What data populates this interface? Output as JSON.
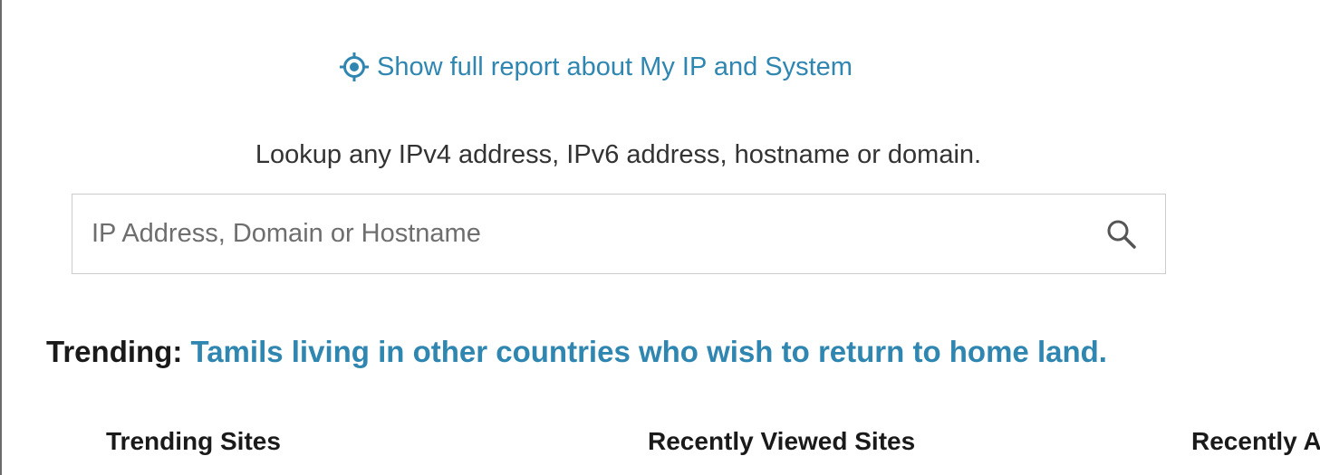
{
  "report_link": {
    "label": "Show full report about My IP and System",
    "icon": "target-icon"
  },
  "lookup": {
    "prompt": "Lookup any IPv4 address, IPv6 address, hostname or domain.",
    "placeholder": "IP Address, Domain or Hostname",
    "value": "",
    "icon": "search-icon"
  },
  "trending": {
    "label": "Trending:",
    "link": "Tamils living in other countries who wish to return to home land."
  },
  "columns": {
    "trending_sites": "Trending Sites",
    "recently_viewed": "Recently Viewed Sites",
    "recently_added": "Recently A"
  },
  "colors": {
    "link": "#2f86b0",
    "text": "#333333",
    "heading": "#1a1a1a",
    "border": "#cccccc"
  }
}
